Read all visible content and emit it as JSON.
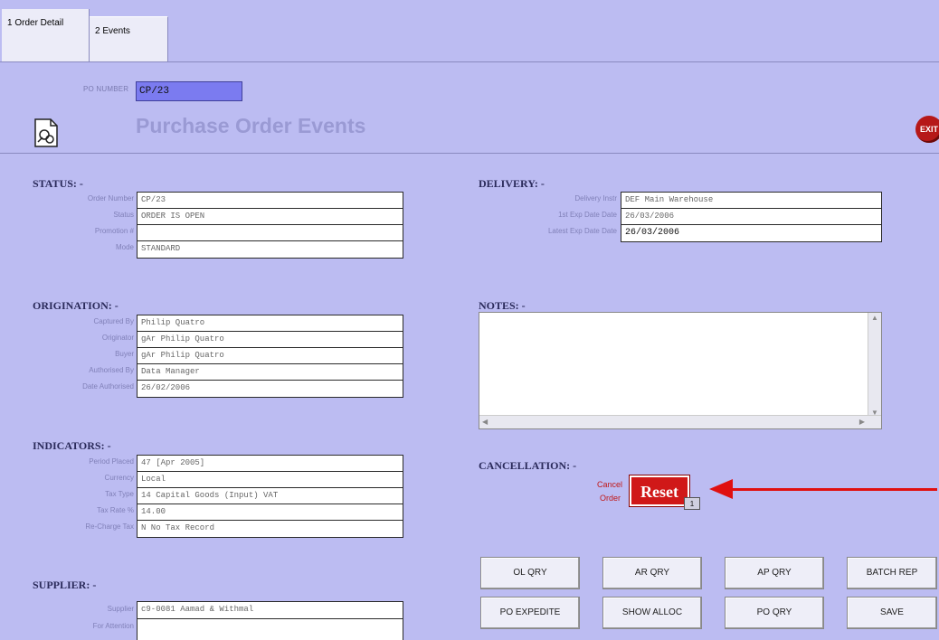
{
  "tabs": [
    {
      "label": "1 Order Detail"
    },
    {
      "label": "2 Events"
    }
  ],
  "header": {
    "po_number_label": "PO NUMBER",
    "po_number": "CP/23",
    "title": "Purchase Order Events",
    "exit_label": "EXIT"
  },
  "status": {
    "heading": "STATUS: -",
    "labels": [
      "Order Number",
      "Status",
      "Promotion #",
      "Mode"
    ],
    "values": [
      "CP/23",
      "ORDER IS OPEN",
      "",
      "STANDARD"
    ]
  },
  "origination": {
    "heading": "ORIGINATION: -",
    "labels": [
      "Captured By",
      "Originator",
      "Buyer",
      "Authorised By",
      "Date Authorised"
    ],
    "values": [
      "Philip Quatro",
      "gAr Philip Quatro",
      "gAr Philip Quatro",
      "Data Manager",
      "26/02/2006"
    ]
  },
  "indicators": {
    "heading": "INDICATORS: -",
    "labels": [
      "Period Placed",
      "Currency",
      "Tax Type",
      "Tax Rate %",
      "Re-Charge Tax"
    ],
    "values": [
      "47  [Apr 2005]",
      "Local",
      "14 Capital Goods (Input) VAT",
      "   14.00",
      "N No Tax Record"
    ]
  },
  "supplier": {
    "heading": "SUPPLIER: -",
    "labels": [
      "Supplier",
      "For Attention"
    ],
    "values": [
      "c9-0081 Aamad & Withmal",
      ""
    ]
  },
  "delivery": {
    "heading": "DELIVERY: -",
    "labels": [
      "Delivery Instr",
      "1st Exp Date Date",
      "Latest Exp Date Date"
    ],
    "values": [
      "DEF Main Warehouse",
      "26/03/2006",
      "26/03/2006"
    ]
  },
  "notes": {
    "heading": "NOTES: -",
    "text": ""
  },
  "cancellation": {
    "heading": "CANCELLATION: -",
    "label_line1": "Cancel",
    "label_line2": "Order",
    "reset_label": "Reset",
    "badge": "1"
  },
  "buttons": {
    "row1": [
      "OL QRY",
      "AR QRY",
      "AP QRY",
      "BATCH REP"
    ],
    "row2": [
      "PO EXPEDITE",
      "SHOW ALLOC",
      "PO QRY",
      "SAVE"
    ]
  },
  "colors": {
    "background": "#bcbcf2",
    "accent_red": "#d01818",
    "po_field": "#7b7bf0"
  }
}
